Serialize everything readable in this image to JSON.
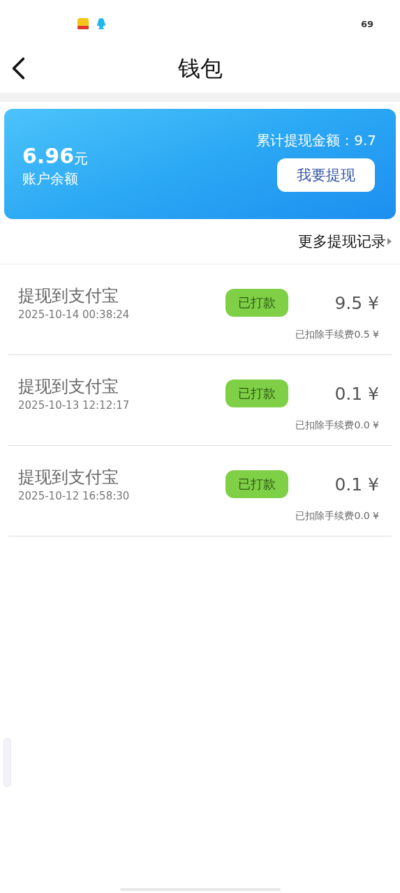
{
  "status_bar": {
    "battery": "69"
  },
  "header": {
    "title": "钱包"
  },
  "balance_card": {
    "amount": "6.96",
    "unit": "元",
    "label": "账户余额",
    "total_withdrawn": "累计提现金额：9.7",
    "withdraw_button": "我要提现"
  },
  "more_link": "更多提现记录",
  "records": [
    {
      "title": "提现到支付宝",
      "time": "2025-10-14 00:38:24",
      "status": "已打款",
      "amount": "9.5 ¥",
      "fee": "已扣除手续费0.5 ¥"
    },
    {
      "title": "提现到支付宝",
      "time": "2025-10-13 12:12:17",
      "status": "已打款",
      "amount": "0.1 ¥",
      "fee": "已扣除手续费0.0 ¥"
    },
    {
      "title": "提现到支付宝",
      "time": "2025-10-12 16:58:30",
      "status": "已打款",
      "amount": "0.1 ¥",
      "fee": "已扣除手续费0.0 ¥"
    }
  ]
}
